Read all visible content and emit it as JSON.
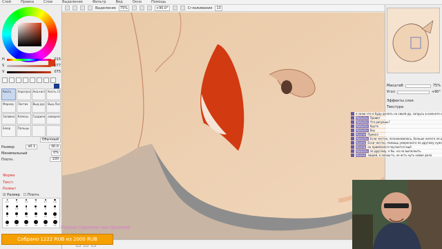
{
  "menu": [
    "Слой",
    "Правка",
    "Слои",
    "Выделение",
    "Фильтр",
    "Вид",
    "Окно",
    "Помощь"
  ],
  "toolbar": {
    "selection_label": "Выделение",
    "zoom": "75%",
    "rotation": "+90.0°",
    "smoothing_label": "Сглаживание",
    "smoothing_value": "13"
  },
  "color": {
    "current": "#d63a12",
    "secondary": "#1a3a8a",
    "sliders": [
      {
        "label": "H",
        "value": "015"
      },
      {
        "label": "S",
        "value": "077"
      },
      {
        "label": "V",
        "value": "075"
      }
    ]
  },
  "tools": [
    "Кисть",
    "Аэрограф",
    "Акв.кисть",
    "Кисть СС",
    "Маркер",
    "Ластик",
    "Выд.рука",
    "Выд.Ласс",
    "Заливка",
    "Кляксы",
    "Градиент",
    "акварель",
    "Блюр",
    "Пальцы",
    "",
    ""
  ],
  "brush_props": {
    "mode_label": "Обычный",
    "size_label": "Размер",
    "size_mult": "x0.1",
    "size_value": "30.0",
    "min_label": "Минимальный",
    "min_value": "0%",
    "density_label": "Плотн.",
    "density_value": "100"
  },
  "sections": [
    "Форма",
    "Текст.",
    "Размыт"
  ],
  "brush_checks": {
    "size": "Размер",
    "density": "Плотн."
  },
  "brush_sizes": [
    "0.7",
    "1",
    "1.5",
    "2",
    "2.3",
    "2.6",
    "3",
    "3.5",
    "4",
    "5",
    "6",
    "7",
    "8",
    "9",
    "10",
    "12",
    "14",
    "16",
    "20",
    "25",
    "30",
    "35",
    "40",
    "50"
  ],
  "right_panel": {
    "magnify_label": "Масштаб",
    "magnify_value": "75%",
    "angle_label": "Угол",
    "angle_value": "+90°",
    "effects_label": "Эффекты слоя",
    "texture_label": "Текстура"
  },
  "chat": [
    {
      "nick": "",
      "text": "я знаю что я буду делать на своей др, запрусь в комнате и не буду выходить"
    },
    {
      "nick": "Natasha",
      "text": "Привет"
    },
    {
      "nick": "Natasha",
      "text": "Что рисуешь?"
    },
    {
      "nick": "Natasha",
      "text": "Круто"
    },
    {
      "nick": "Natasha",
      "text": "Вау"
    },
    {
      "nick": "Kosmo",
      "text": "Прикол"
    },
    {
      "nick": "Natasha",
      "text": "Если честно, познакомилась, больше ничего не делаю"
    },
    {
      "nick": "Kosmo",
      "text": "Если честно, помощь умеренного по другому нужно было нарисовать и делать расположить но пусть. Мне лень, нужно не выполнять"
    },
    {
      "nick": "Kosmo",
      "text": "он привязался поучается ещё"
    },
    {
      "nick": "Natasha",
      "text": "по другому. я бы. но не выполнить"
    },
    {
      "nick": "Kosmo",
      "text": "людей, а назад-то, не есть нуть новое дела"
    }
  ],
  "watermark": "Разносторонее настроение",
  "donation": {
    "text": "Собрано 1222 RUB из 2000 RUB",
    "raised": 1222,
    "goal": 2000
  }
}
